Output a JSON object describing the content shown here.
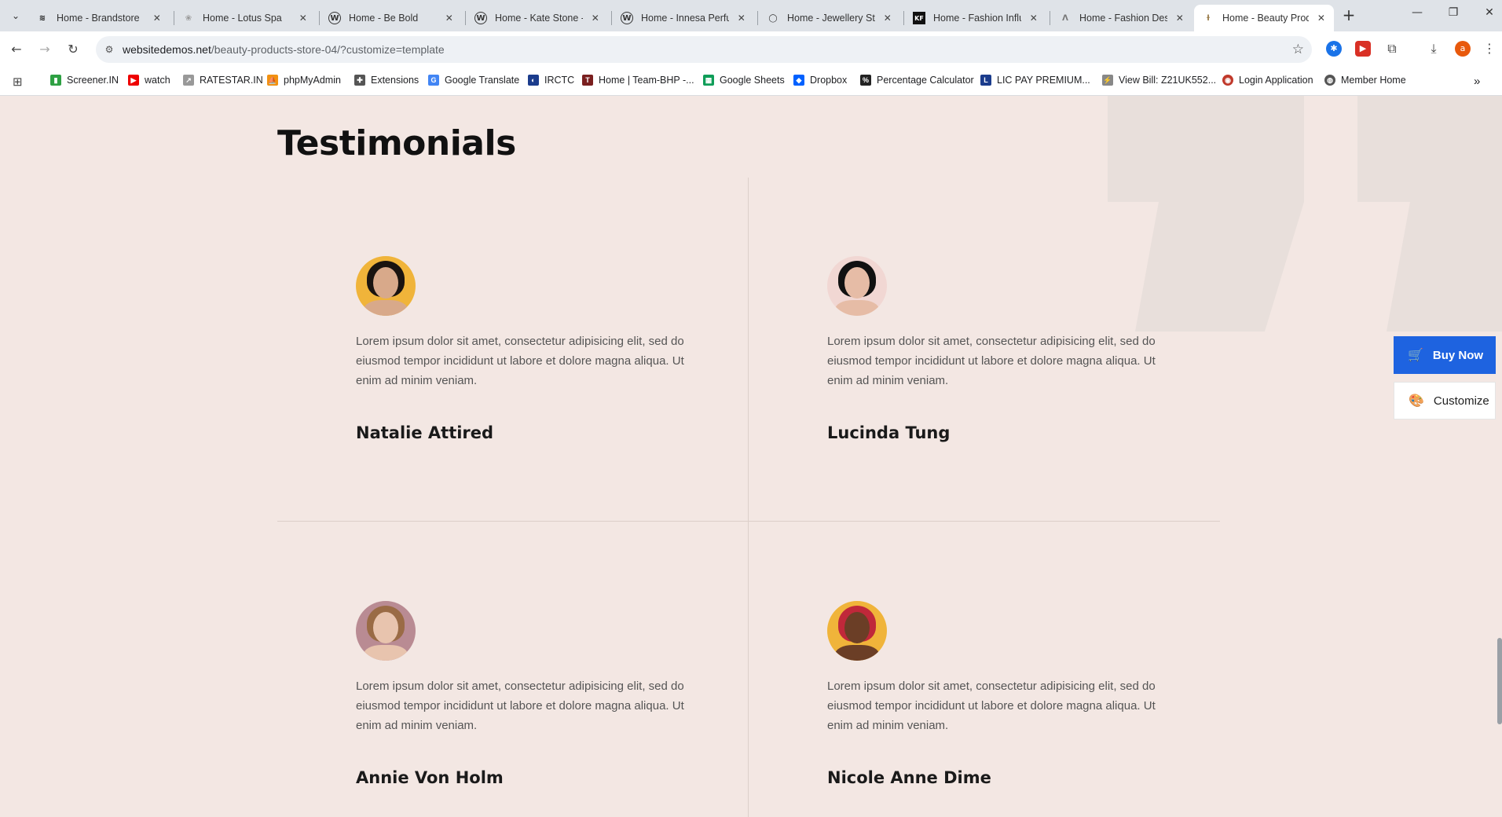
{
  "browser": {
    "tabs": [
      {
        "title": "Home - Brandstore",
        "favicon": "brandstore-icon"
      },
      {
        "title": "Home - Lotus Spa",
        "favicon": "lotus-icon"
      },
      {
        "title": "Home - Be Bold",
        "favicon": "wordpress-icon"
      },
      {
        "title": "Home - Kate Stone -",
        "favicon": "wordpress-icon"
      },
      {
        "title": "Home - Innesa Perfum",
        "favicon": "wordpress-icon"
      },
      {
        "title": "Home - Jewellery Sto",
        "favicon": "ring-icon"
      },
      {
        "title": "Home - Fashion Influ",
        "favicon": "kf-icon"
      },
      {
        "title": "Home - Fashion Desi",
        "favicon": "fashion-icon"
      },
      {
        "title": "Home - Beauty Produ",
        "favicon": "leaf-icon",
        "active": true
      }
    ],
    "url": {
      "host": "websitedemos.net",
      "path": "/beauty-products-store-04/?customize=template"
    },
    "profile_initial": "a",
    "bookmarks": [
      {
        "label": "Screener.IN",
        "color": "#2ea043"
      },
      {
        "label": "watch",
        "color": "#e00"
      },
      {
        "label": "RATESTAR.IN",
        "color": "#888"
      },
      {
        "label": "phpMyAdmin",
        "color": "#f29111"
      },
      {
        "label": "Extensions",
        "color": "#555"
      },
      {
        "label": "Google Translate",
        "color": "#4285f4"
      },
      {
        "label": "IRCTC",
        "color": "#1b3c8c"
      },
      {
        "label": "Home | Team-BHP -...",
        "color": "#7a1f1f"
      },
      {
        "label": "Google Sheets",
        "color": "#0f9d58"
      },
      {
        "label": "Dropbox",
        "color": "#0061ff"
      },
      {
        "label": "Percentage Calculator",
        "color": "#222"
      },
      {
        "label": "LIC PAY PREMIUM...",
        "color": "#1b3c8c"
      },
      {
        "label": "View Bill: Z21UK552...",
        "color": "#888"
      },
      {
        "label": "Login Application",
        "color": "#c0392b"
      },
      {
        "label": "Member Home",
        "color": "#555"
      }
    ]
  },
  "section": {
    "title": "Testimonials"
  },
  "testimonials": [
    {
      "quote": "Lorem ipsum dolor sit amet, consectetur adipisicing elit, sed do eiusmod tempor incididunt ut labore et dolore magna aliqua. Ut enim ad minim veniam.",
      "name": "Natalie Attired",
      "bg": "#f0b43a",
      "hair": "#1a1410",
      "skin": "#d8a98a"
    },
    {
      "quote": "Lorem ipsum dolor sit amet, consectetur adipisicing elit, sed do eiusmod tempor incididunt ut labore et dolore magna aliqua. Ut enim ad minim veniam.",
      "name": "Lucinda Tung",
      "bg": "#f1d7d3",
      "hair": "#111",
      "skin": "#e6bca6"
    },
    {
      "quote": "Lorem ipsum dolor sit amet, consectetur adipisicing elit, sed do eiusmod tempor incididunt ut labore et dolore magna aliqua. Ut enim ad minim veniam.",
      "name": "Annie Von Holm",
      "bg": "#b98b93",
      "hair": "#9a6b45",
      "skin": "#e8c4ae"
    },
    {
      "quote": "Lorem ipsum dolor sit amet, consectetur adipisicing elit, sed do eiusmod tempor incididunt ut labore et dolore magna aliqua. Ut enim ad minim veniam.",
      "name": "Nicole Anne Dime",
      "bg": "#f0b43a",
      "hair": "#c0283a",
      "skin": "#6b3e26"
    }
  ],
  "cta": {
    "buy_label": "Buy Now",
    "customize_label": "Customize"
  },
  "colors": {
    "accent": "#1e63e0",
    "page_bg": "#f3e7e3"
  }
}
